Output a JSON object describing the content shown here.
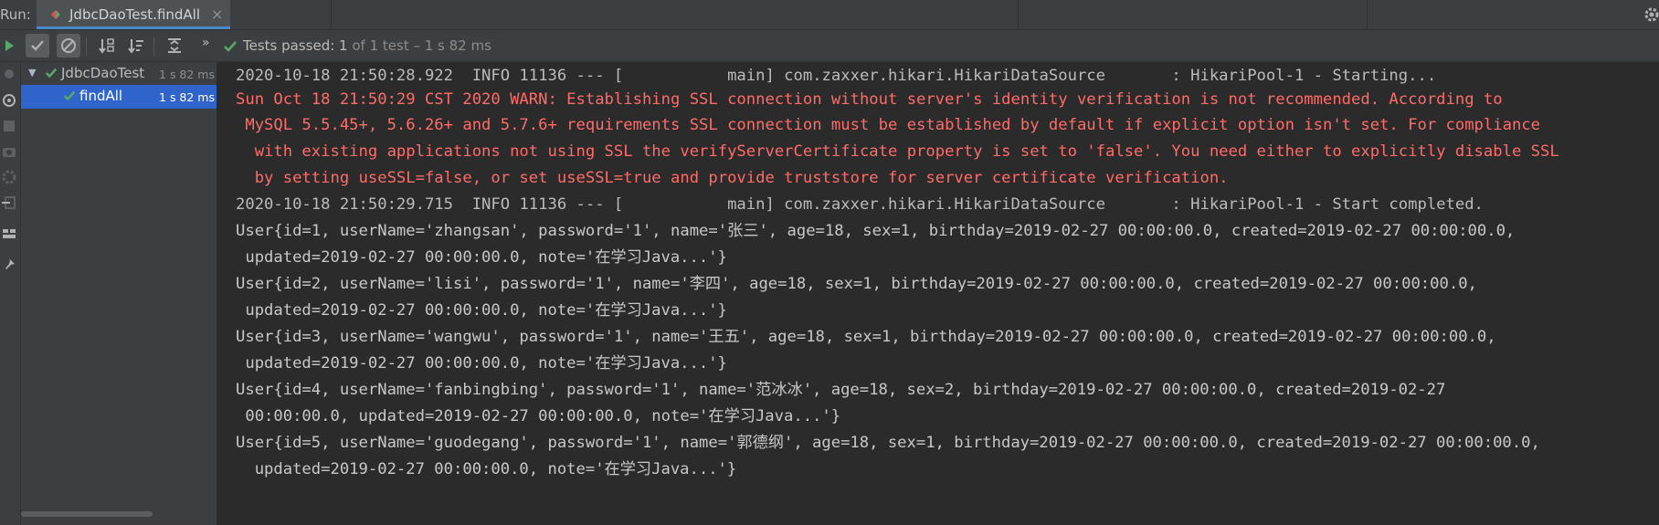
{
  "run_header": {
    "run_label": "Run:",
    "tab_title": "JdbcDaoTest.findAll",
    "tab_close": "×"
  },
  "toolbar": {
    "more": "»",
    "status_prefix": "Tests passed: ",
    "status_count": "1",
    "status_detail": " of 1 test – 1 s 82 ms"
  },
  "tree": {
    "root": {
      "arrow": "▼",
      "name": "JdbcDaoTest",
      "time": "1 s 82 ms"
    },
    "child": {
      "name": "findAll",
      "time": "1 s 82 ms"
    }
  },
  "console": {
    "lines": [
      "2020-10-18 21:50:28.922  INFO 11136 --- [           main] com.zaxxer.hikari.HikariDataSource       : HikariPool-1 - Starting...",
      "Sun Oct 18 21:50:29 CST 2020 WARN: Establishing SSL connection without server's identity verification is not recommended. According to",
      " MySQL 5.5.45+, 5.6.26+ and 5.7.6+ requirements SSL connection must be established by default if explicit option isn't set. For compliance",
      "  with existing applications not using SSL the verifyServerCertificate property is set to 'false'. You need either to explicitly disable SSL",
      "  by setting useSSL=false, or set useSSL=true and provide truststore for server certificate verification.",
      "2020-10-18 21:50:29.715  INFO 11136 --- [           main] com.zaxxer.hikari.HikariDataSource       : HikariPool-1 - Start completed.",
      "User{id=1, userName='zhangsan', password='1', name='张三', age=18, sex=1, birthday=2019-02-27 00:00:00.0, created=2019-02-27 00:00:00.0,",
      " updated=2019-02-27 00:00:00.0, note='在学习Java...'}",
      "User{id=2, userName='lisi', password='1', name='李四', age=18, sex=1, birthday=2019-02-27 00:00:00.0, created=2019-02-27 00:00:00.0,",
      " updated=2019-02-27 00:00:00.0, note='在学习Java...'}",
      "User{id=3, userName='wangwu', password='1', name='王五', age=18, sex=1, birthday=2019-02-27 00:00:00.0, created=2019-02-27 00:00:00.0,",
      " updated=2019-02-27 00:00:00.0, note='在学习Java...'}",
      "User{id=4, userName='fanbingbing', password='1', name='范冰冰', age=18, sex=2, birthday=2019-02-27 00:00:00.0, created=2019-02-27",
      " 00:00:00.0, updated=2019-02-27 00:00:00.0, note='在学习Java...'}",
      "User{id=5, userName='guodegang', password='1', name='郭德纲', age=18, sex=1, birthday=2019-02-27 00:00:00.0, created=2019-02-27 00:00:00.0,",
      "  updated=2019-02-27 00:00:00.0, note='在学习Java...'}"
    ]
  },
  "colors": {
    "info": "#bbbbbb",
    "warn": "#ff6b68",
    "pass_green": "#59a869",
    "selection": "#2f65ca"
  }
}
